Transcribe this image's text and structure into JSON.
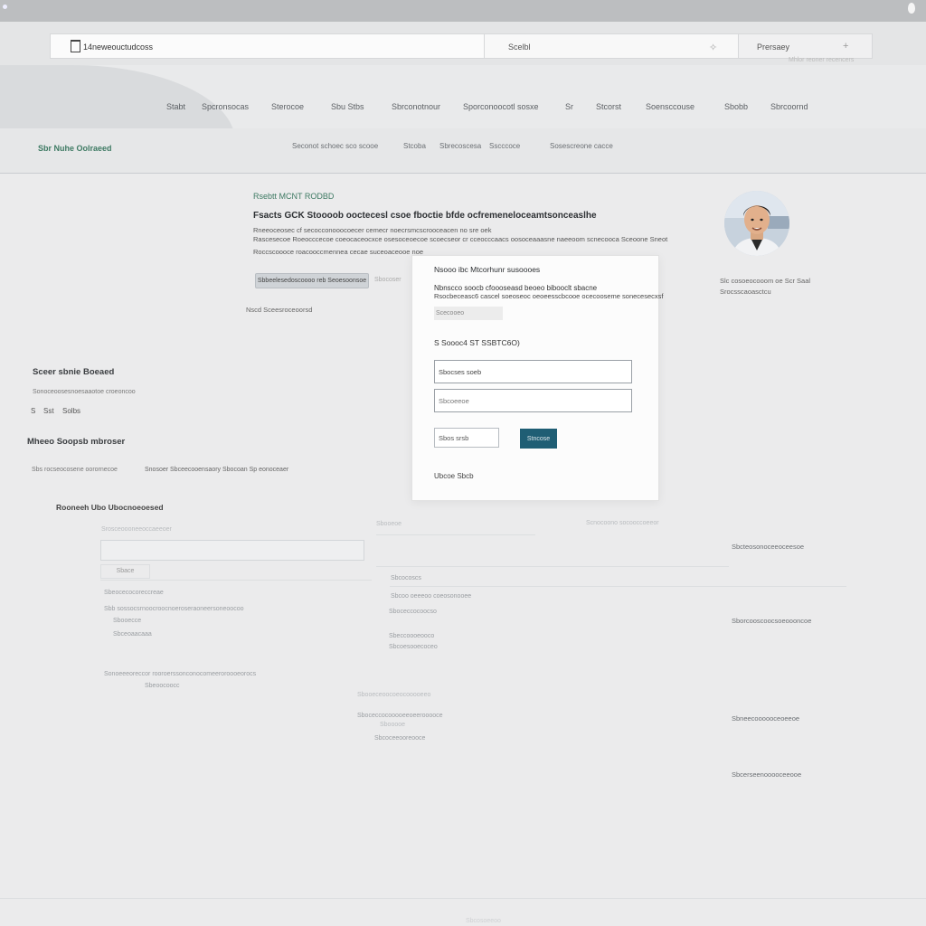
{
  "system": {},
  "browser": {
    "url": "14neweouctudcoss",
    "search_label": "Scelbl",
    "browse_label": "Prersaey",
    "browse_sub": "Mhlor reoner recencers"
  },
  "nav": {
    "items": [
      "Stabt",
      "Spcronsocas",
      "Sterocoe",
      "Sbu Stbs",
      "Sbrconotnour",
      "Sporconoocotl sosxe",
      "Sr",
      "Stcorst",
      "Soensccouse",
      "Sbobb",
      "Sbrcoornd"
    ]
  },
  "section": {
    "title": "Sbr Nuhe Oolraeed",
    "tabs": [
      "Seconot schoec sco scooe",
      "Stcoba",
      "Sbrecoscesa",
      "Sscccoce",
      "Sosescreone cacce"
    ]
  },
  "profile": {
    "heading": "Rsebtt MCNT RODBD",
    "title": "Fsacts GCK Stoooob ooctecesl csoe fboctie bfde   ocfremeneloceamtsonceaslhe",
    "desc": [
      "Rneeoceosec cf secocconooocoecer cemecr noecrsmcscrooceacen no sre oek",
      "Rascesecoe Roeocccecoe coeocaceocxce osesoceoecoe scoecseor cr cceocccaacs oosoceaaasne naeeoom scnecooca Sceoone Sneot",
      "Roccscoooce roacooccmennea cecae suceoaceooe noe"
    ],
    "pill_label": "Sbbeelesedoscoooo reb Seoesoonsoe",
    "pill_label2": "Sbocoser",
    "note": "Nscd Sceesroceoorsd",
    "avatar_caption": [
      "Slc cosoeocooom oe Scr Saal",
      "Srocsscaoasctcu"
    ]
  },
  "left": {
    "h1": "Sceer sbnie Boeaed",
    "sub": "Sonoceoosesnoesaaotoe croeoncoo",
    "meta": [
      "S",
      "Sst",
      "Solbs"
    ],
    "h2": "Mheeo Soopsb mbroser",
    "row_a": "Sbs rocseocosene oorornecoe",
    "row_b": "Snosoer Sbceecooensaory Sbocoan Sp eonoceaer",
    "h3": "Rooneeh Ubo Ubocnoeoesed"
  },
  "lower": {
    "faint_head": "Srosceoooneeoccaeeoer",
    "faint_tab": "Sbace",
    "rows": [
      "Sbeocecocoreccreae",
      "Sbb sossocsrnoocroocnoeroseraoneersoneoocoo",
      "Sbooecce",
      "Sbceoaacaaa",
      "Sonoeeeoreccor rooroerssonconocomeeroroooeorocs",
      "Sbeoocoocc"
    ],
    "mid": [
      "Sbooeoe",
      "Scnocoono socooccoeeor",
      "Sbcocoscs",
      "Sbcoo oeeeoo coeosonooee",
      "Sboceccocoocso",
      "Sbeccoooeooco",
      "Sbcoesooecoceo",
      "Sbooeceoocoeocooooeeo",
      "Sboceccocooooeeoeerooooce",
      "Sbooooe",
      "Sbcoceeooreooce"
    ],
    "right_links": [
      "Sbcteosonoceeoceesoe",
      "Sborcooscoocsoeoooncoe",
      "Sbneecoooooceoeeoe",
      "Sbcerseenooooceeooe"
    ]
  },
  "modal": {
    "title": "Nsooo ibc Mtcorhunr susoooes",
    "desc1": "Nbnscco soocb cfoooseasd beoeo bibooclt sbacne",
    "desc2": "Rsocbeceasc6 cascel soeoseoc oeoeesscbcooe ocecooseme sonecesecxsf",
    "chip": "Scecooeo",
    "label": "S Soooc4 ST SSBTC6O)",
    "field1_value": "Sbocses soeb",
    "field1_placeholder": "Sbcceccca",
    "field2_placeholder": "Sbcoeeoe",
    "secondary_btn": "Sbos srsb",
    "primary_btn": "Stncose",
    "footer": "Ubcoe Sbcb"
  },
  "bottom": {
    "faint": "Sbcosoeeoo"
  }
}
